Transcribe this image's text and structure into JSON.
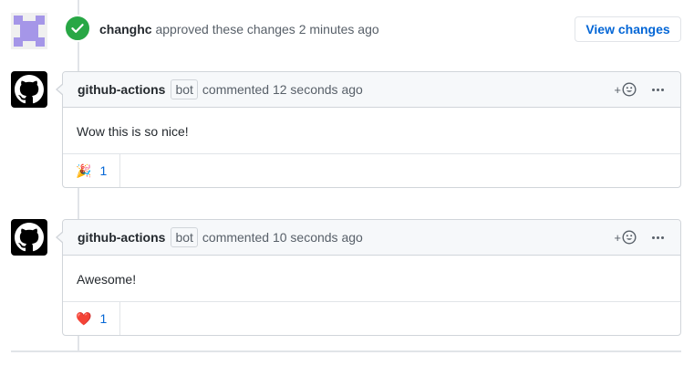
{
  "approval": {
    "author": "changhc",
    "action": "approved these changes",
    "time": "2 minutes ago",
    "button_label": "View changes",
    "badge_color": "#28a745"
  },
  "comments": [
    {
      "author": "github-actions",
      "badge": "bot",
      "action": "commented",
      "time": "12 seconds ago",
      "body": "Wow this is so nice!",
      "reaction_emoji": "🎉",
      "reaction_count": "1"
    },
    {
      "author": "github-actions",
      "badge": "bot",
      "action": "commented",
      "time": "10 seconds ago",
      "body": "Awesome!",
      "reaction_emoji": "❤️",
      "reaction_count": "1"
    }
  ],
  "icons": {
    "approval_avatar": "identicon-avatar",
    "approve_badge": "check-icon",
    "comment_avatar": "github-octocat-icon",
    "add_reaction": "smiley-icon",
    "more_actions": "kebab-horizontal-icon"
  },
  "colors": {
    "link": "#0366d6",
    "identicon": "#a596e8"
  }
}
